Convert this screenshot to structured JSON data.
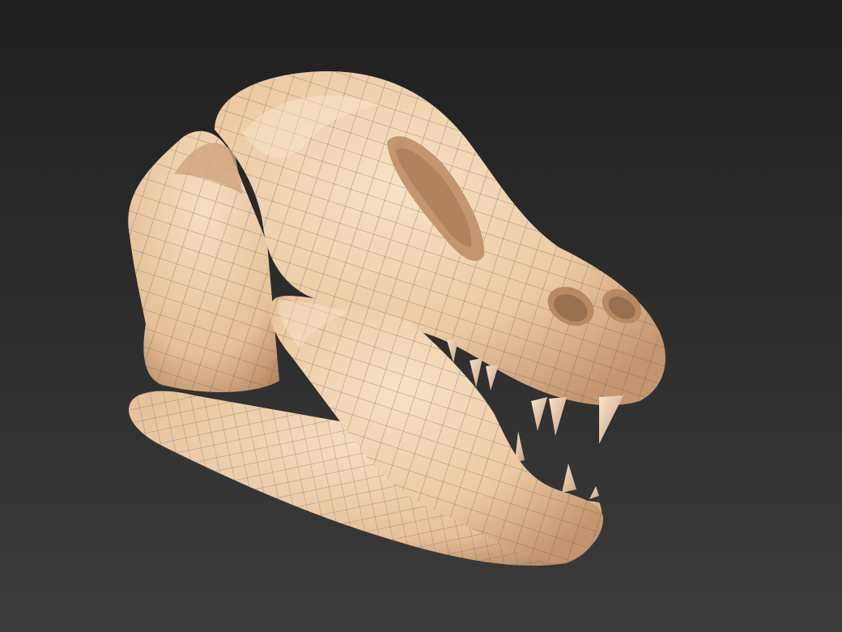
{
  "scene": {
    "subject": "dinosaur-skull-wireframe-model",
    "colors": {
      "background_top": "#1f1f1f",
      "background_bottom": "#3b3b3b",
      "bone_light": "#f6dcbc",
      "bone_mid": "#e9c39a",
      "bone_shadow": "#b98c63",
      "wire": "#5a5450"
    }
  }
}
